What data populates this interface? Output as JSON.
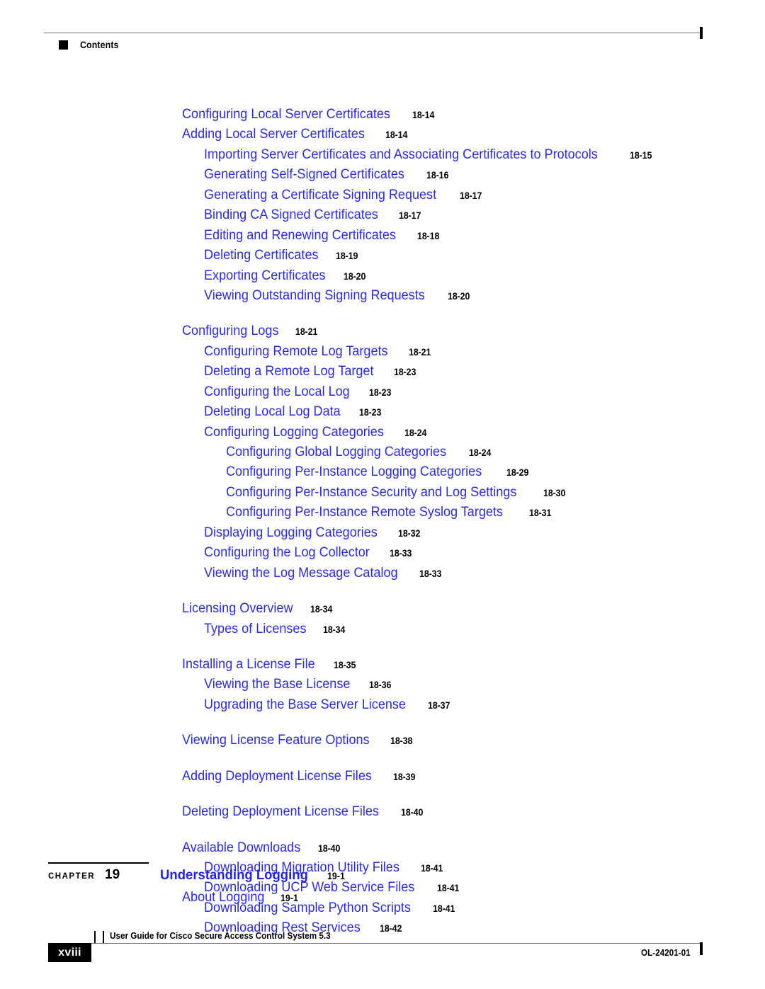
{
  "colors": {
    "link_blue": "#2A2AE8",
    "chapter_blue": "#2222E6",
    "rule_gray": "#6E6E6E",
    "text_black": "#000000"
  },
  "header": {
    "label": "Contents",
    "marker_icon": "black-square-icon"
  },
  "toc": {
    "entries": [
      {
        "level": 1,
        "title": "Configuring Local Server Certificates",
        "page": "18-14",
        "gap_before": false
      },
      {
        "level": 1,
        "title": "Adding Local Server Certificates",
        "page": "18-14",
        "gap_before": false
      },
      {
        "level": 2,
        "title": "Importing Server Certificates and Associating Certificates to Protocols",
        "page": "18-15",
        "gap_before": false
      },
      {
        "level": 2,
        "title": "Generating Self-Signed Certificates",
        "page": "18-16",
        "gap_before": false
      },
      {
        "level": 2,
        "title": "Generating a Certificate Signing Request",
        "page": "18-17",
        "gap_before": false
      },
      {
        "level": 2,
        "title": "Binding CA Signed Certificates",
        "page": "18-17",
        "gap_before": false
      },
      {
        "level": 2,
        "title": "Editing and Renewing Certificates",
        "page": "18-18",
        "gap_before": false
      },
      {
        "level": 2,
        "title": "Deleting Certificates",
        "page": "18-19",
        "gap_before": false
      },
      {
        "level": 2,
        "title": "Exporting Certificates",
        "page": "18-20",
        "gap_before": false
      },
      {
        "level": 2,
        "title": "Viewing Outstanding Signing Requests",
        "page": "18-20",
        "gap_before": false
      },
      {
        "level": 1,
        "title": "Configuring Logs",
        "page": "18-21",
        "gap_before": true
      },
      {
        "level": 2,
        "title": "Configuring Remote Log Targets",
        "page": "18-21",
        "gap_before": false
      },
      {
        "level": 2,
        "title": "Deleting a Remote Log Target",
        "page": "18-23",
        "gap_before": false
      },
      {
        "level": 2,
        "title": "Configuring the Local Log",
        "page": "18-23",
        "gap_before": false
      },
      {
        "level": 2,
        "title": "Deleting Local Log Data",
        "page": "18-23",
        "gap_before": false
      },
      {
        "level": 2,
        "title": "Configuring Logging Categories",
        "page": "18-24",
        "gap_before": false
      },
      {
        "level": 3,
        "title": "Configuring Global Logging Categories",
        "page": "18-24",
        "gap_before": false
      },
      {
        "level": 3,
        "title": "Configuring Per-Instance Logging Categories",
        "page": "18-29",
        "gap_before": false
      },
      {
        "level": 3,
        "title": "Configuring Per-Instance Security and Log Settings",
        "page": "18-30",
        "gap_before": false
      },
      {
        "level": 3,
        "title": "Configuring Per-Instance Remote Syslog Targets",
        "page": "18-31",
        "gap_before": false
      },
      {
        "level": 2,
        "title": "Displaying Logging Categories",
        "page": "18-32",
        "gap_before": false
      },
      {
        "level": 2,
        "title": "Configuring the Log Collector",
        "page": "18-33",
        "gap_before": false
      },
      {
        "level": 2,
        "title": "Viewing the Log Message Catalog",
        "page": "18-33",
        "gap_before": false
      },
      {
        "level": 1,
        "title": "Licensing Overview",
        "page": "18-34",
        "gap_before": true
      },
      {
        "level": 2,
        "title": "Types of Licenses",
        "page": "18-34",
        "gap_before": false
      },
      {
        "level": 1,
        "title": "Installing a License File",
        "page": "18-35",
        "gap_before": true
      },
      {
        "level": 2,
        "title": "Viewing the Base License",
        "page": "18-36",
        "gap_before": false
      },
      {
        "level": 2,
        "title": "Upgrading the Base Server License",
        "page": "18-37",
        "gap_before": false
      },
      {
        "level": 1,
        "title": "Viewing License Feature Options",
        "page": "18-38",
        "gap_before": true
      },
      {
        "level": 1,
        "title": "Adding Deployment License Files",
        "page": "18-39",
        "gap_before": true
      },
      {
        "level": 1,
        "title": "Deleting Deployment License Files",
        "page": "18-40",
        "gap_before": true
      },
      {
        "level": 1,
        "title": "Available Downloads",
        "page": "18-40",
        "gap_before": true
      },
      {
        "level": 2,
        "title": "Downloading Migration Utility Files",
        "page": "18-41",
        "gap_before": false
      },
      {
        "level": 2,
        "title": "Downloading UCP Web Service Files",
        "page": "18-41",
        "gap_before": false
      },
      {
        "level": 2,
        "title": "Downloading Sample Python Scripts",
        "page": "18-41",
        "gap_before": false
      },
      {
        "level": 2,
        "title": "Downloading Rest Services",
        "page": "18-42",
        "gap_before": false
      }
    ]
  },
  "chapter": {
    "word": "CHAPTER",
    "number": "19",
    "title": "Understanding Logging",
    "page": "19-1",
    "sub_title": "About Logging",
    "sub_page": "19-1"
  },
  "footer": {
    "folio": "xviii",
    "book_title": "User Guide for Cisco Secure Access Control System 5.3",
    "doc_id": "OL-24201-01"
  }
}
